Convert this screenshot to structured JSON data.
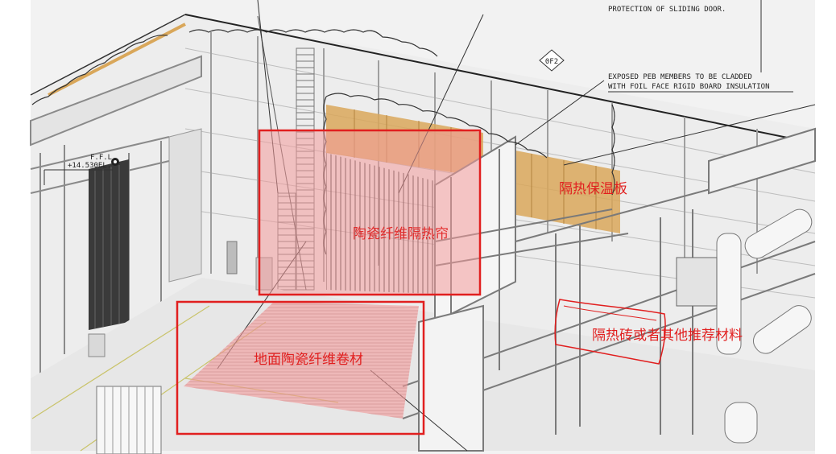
{
  "notes": {
    "top": "PROTECTION OF SLIDING DOOR.",
    "insulation_line1": "EXPOSED PEB MEMBERS TO BE CLADDED",
    "insulation_line2": "WITH FOIL FACE RIGID BOARD INSULATION",
    "grid_tag": "0F2",
    "level_label": "F.F.L.",
    "level_value": "+14.530EL."
  },
  "annotations": {
    "ceramic_curtain": "陶瓷纤维隔热帘",
    "insulation_board": "隔热保温板",
    "ground_blanket": "地面陶瓷纤维卷材",
    "brick": "隔热砖或者其他推荐材料"
  },
  "colors": {
    "markup_red": "#e11f1f",
    "pink_fill": "#f39a9a",
    "insulation_orange": "#d9a75a",
    "line": "#555555"
  }
}
